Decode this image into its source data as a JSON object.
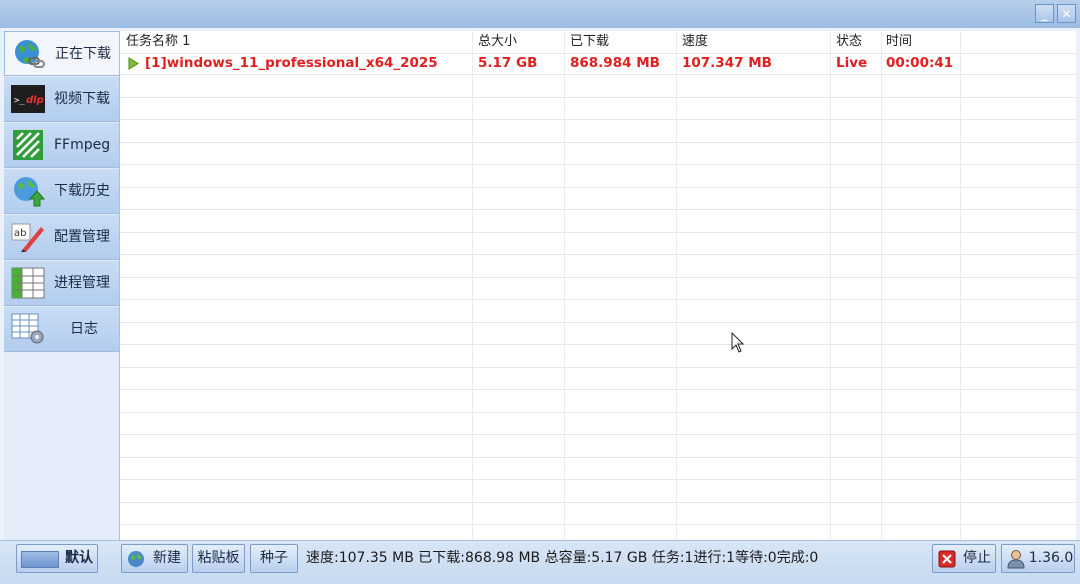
{
  "window": {
    "minimize_glyph": "_",
    "close_glyph": "✕"
  },
  "sidebar": {
    "items": [
      {
        "label": "正在下载",
        "icon": "globe-link-icon",
        "active": true
      },
      {
        "label": "视频下载",
        "icon": "dlp-terminal-icon"
      },
      {
        "label": "FFmpeg",
        "icon": "ffmpeg-icon"
      },
      {
        "label": "下载历史",
        "icon": "globe-up-arrow-icon"
      },
      {
        "label": "配置管理",
        "icon": "ab-edit-icon"
      },
      {
        "label": "进程管理",
        "icon": "grid-table-icon"
      },
      {
        "label": "日志",
        "icon": "table-gear-icon"
      }
    ],
    "profile_button": "默认"
  },
  "table": {
    "columns": [
      "任务名称 1",
      "总大小",
      "已下载",
      "速度",
      "状态",
      "时间"
    ],
    "rows": [
      {
        "name": "[1]windows_11_professional_x64_2025",
        "size": "5.17 GB",
        "downloaded": "868.984 MB",
        "speed": "107.347 MB",
        "status": "Live",
        "time": "00:00:41"
      }
    ]
  },
  "bottom": {
    "new_button": "新建",
    "paste_button": "粘贴板",
    "seed_button": "种子",
    "status_text": "速度:107.35 MB 已下载:868.98 MB 总容量:5.17 GB 任务:1进行:1等待:0完成:0",
    "stop_button": "停止",
    "version_button": "1.36.0"
  },
  "colors": {
    "accent_red": "#e02020",
    "header_blue": "#b6cfec"
  }
}
